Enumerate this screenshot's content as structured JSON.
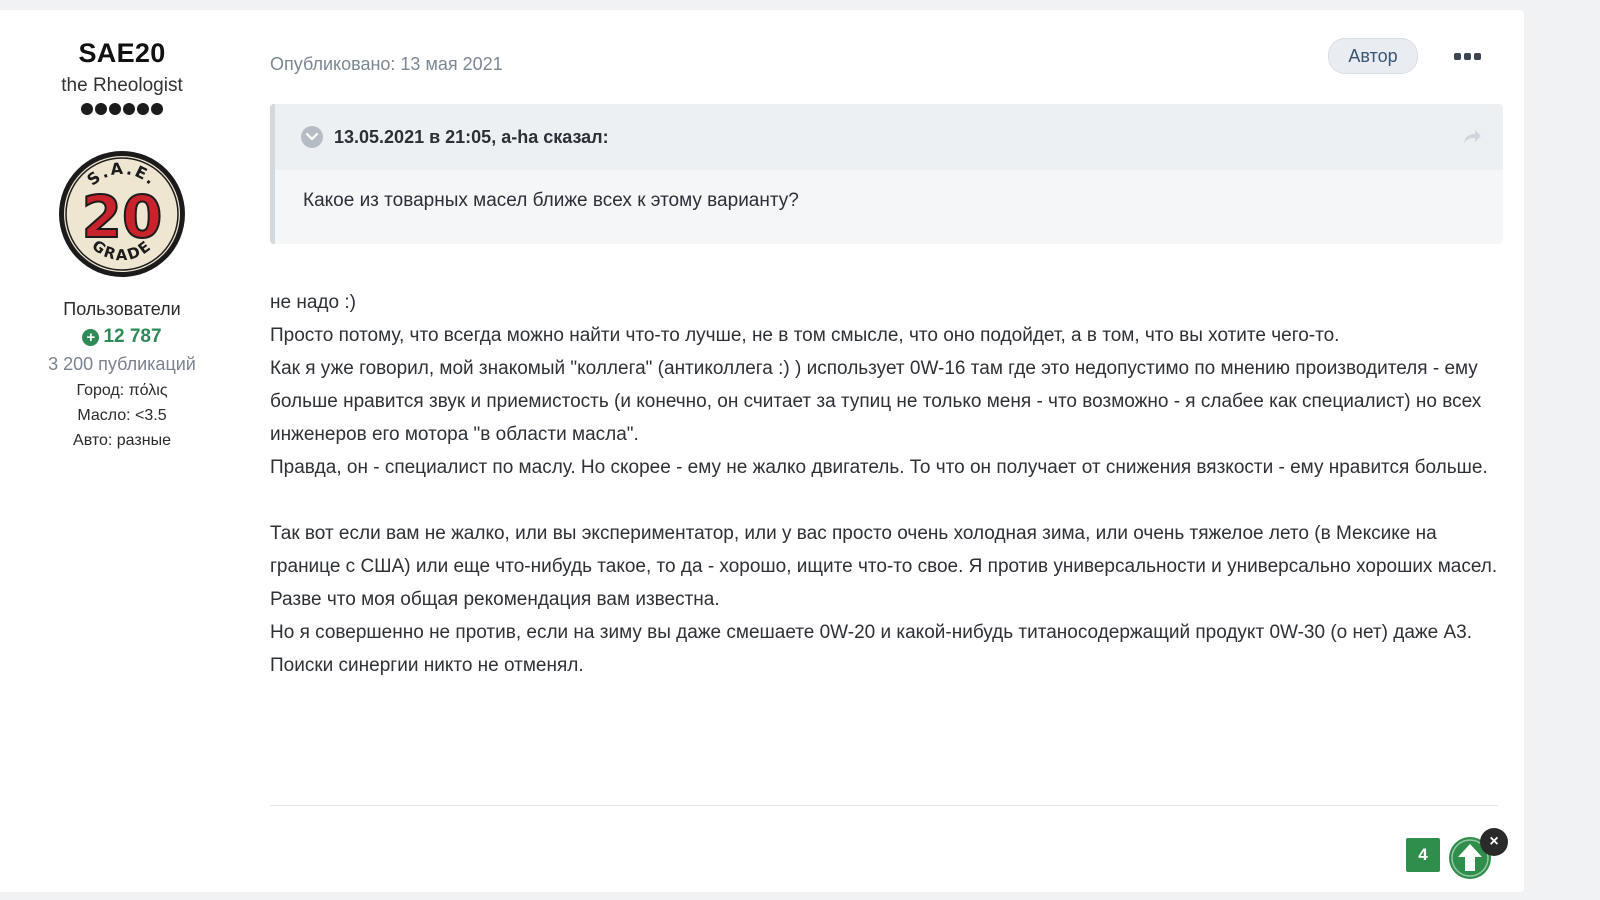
{
  "author": {
    "name": "SAE20",
    "title": "the Rheologist",
    "rank_dots": 6,
    "avatar": {
      "top_text": "S.A.E.",
      "number": "20",
      "bottom_text": "GRADE",
      "accent_color": "#c8232c"
    },
    "group": "Пользователи",
    "reputation": "12 787",
    "posts": "3 200 публикаций",
    "fields": [
      "Город: πόλις",
      "Масло: <3.5",
      "Авто: разные"
    ]
  },
  "post": {
    "published": "Опубликовано: 13 мая 2021",
    "author_badge": "Автор",
    "quote": {
      "citation": "13.05.2021 в 21:05, a-ha сказал:",
      "text": "Какое из товарных масел ближе всех к этому варианту?"
    },
    "paragraphs": [
      "не надо :)",
      "Просто потому, что всегда можно найти что-то лучше, не в том смысле, что оно подойдет, а в том, что вы хотите чего-то.",
      "Как я уже говорил, мой знакомый \"коллега\" (антиколлега :) ) использует 0W-16 там где это недопустимо по мнению производителя - ему больше нравится звук и приемистость (и конечно, он считает за тупиц не только меня - что возможно - я слабее как специалист) но всех инженеров его мотора \"в области масла\".",
      "Правда, он - специалист по маслу. Но скорее - ему не жалко двигатель. То что он получает от снижения вязкости - ему нравится больше.",
      "",
      "Так вот если вам не жалко, или вы экспериментатор, или у вас просто очень холодная зима, или очень тяжелое лето (в Мексике на границе с США) или еще что-нибудь такое, то да - хорошо, ищите что-то свое. Я против универсальности и универсально хороших масел.",
      "Разве что моя общая рекомендация вам известна.",
      "Но я совершенно не против, если на зиму вы даже смешаете 0W-20 и какой-нибудь титаносодержащий продукт 0W-30 (о нет) даже А3. Поиски синергии никто не отменял."
    ],
    "reaction_count": "4",
    "close_label": "×"
  },
  "colors": {
    "reputation": "#2e8b57",
    "reaction": "#2f8e4b",
    "meta": "#7c8794"
  }
}
